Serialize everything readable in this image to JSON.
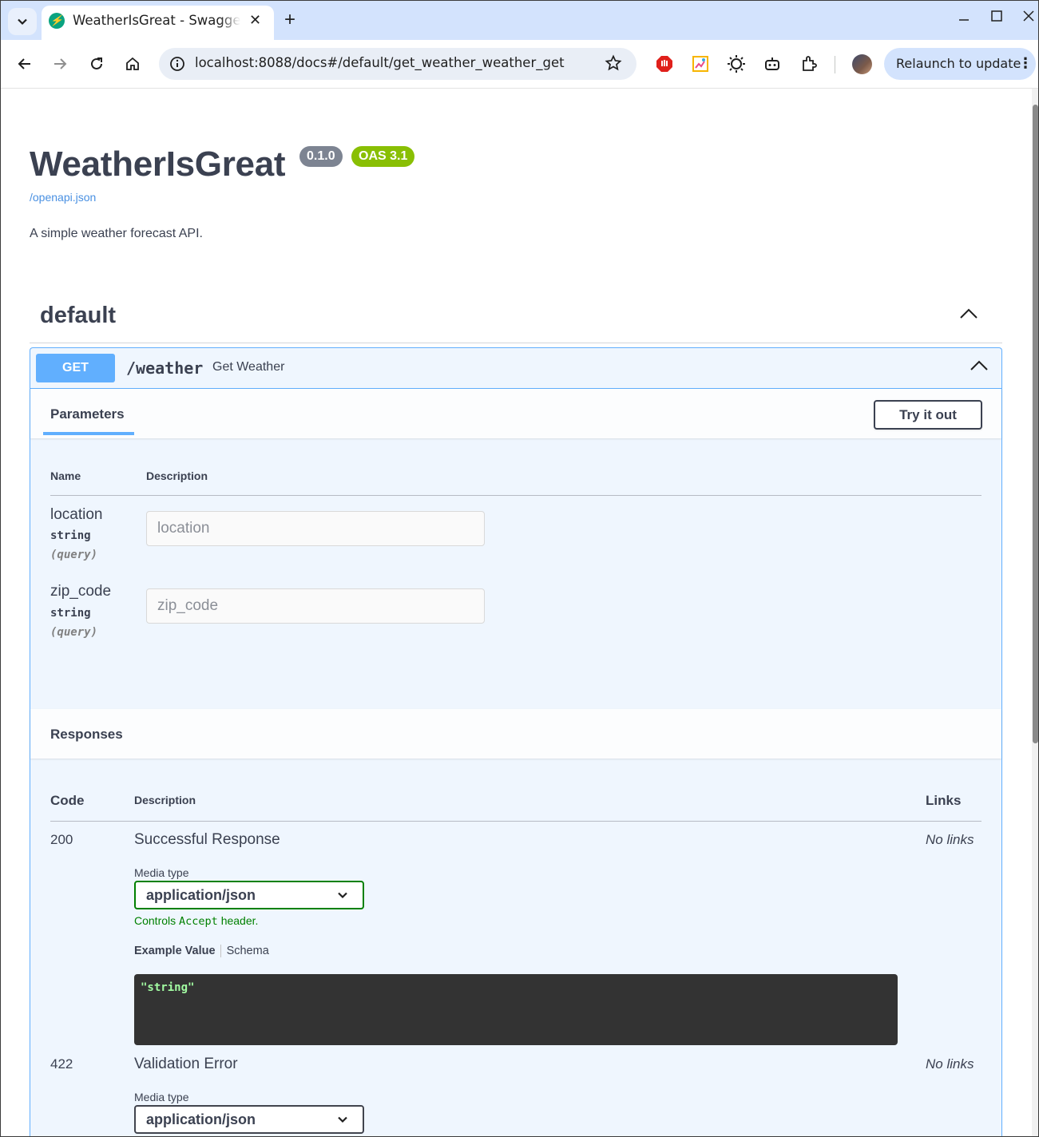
{
  "browser": {
    "tab_title": "WeatherIsGreat - Swagger UI",
    "url": "localhost:8088/docs#/default/get_weather_weather_get",
    "relaunch_label": "Relaunch to update"
  },
  "api": {
    "title": "WeatherIsGreat",
    "version_badge": "0.1.0",
    "oas_badge": "OAS 3.1",
    "spec_link": "/openapi.json",
    "description": "A simple weather forecast API."
  },
  "tag": {
    "name": "default"
  },
  "operation": {
    "method": "GET",
    "path": "/weather",
    "summary": "Get Weather",
    "parameters_tab": "Parameters",
    "try_it_out": "Try it out",
    "param_headers": {
      "name": "Name",
      "description": "Description"
    },
    "parameters": [
      {
        "name": "location",
        "type": "string",
        "in": "(query)",
        "placeholder": "location"
      },
      {
        "name": "zip_code",
        "type": "string",
        "in": "(query)",
        "placeholder": "zip_code"
      }
    ],
    "responses_title": "Responses",
    "response_headers": {
      "code": "Code",
      "description": "Description",
      "links": "Links"
    },
    "responses": [
      {
        "code": "200",
        "description": "Successful Response",
        "links": "No links",
        "media_type_label": "Media type",
        "media_type": "application/json",
        "controls_note_pre": "Controls ",
        "controls_note_code": "Accept",
        "controls_note_post": " header.",
        "example_tab": "Example Value",
        "schema_tab": "Schema",
        "example_value": "\"string\""
      },
      {
        "code": "422",
        "description": "Validation Error",
        "links": "No links",
        "media_type_label": "Media type",
        "media_type": "application/json"
      }
    ]
  },
  "colors": {
    "get_method": "#61affe",
    "opblock_bg": "#eff6fe",
    "version_badge": "#7d8492",
    "oas_badge": "#89bf04",
    "link": "#4990e2",
    "media_ok_border": "#008000",
    "example_text": "#a2fca2"
  }
}
